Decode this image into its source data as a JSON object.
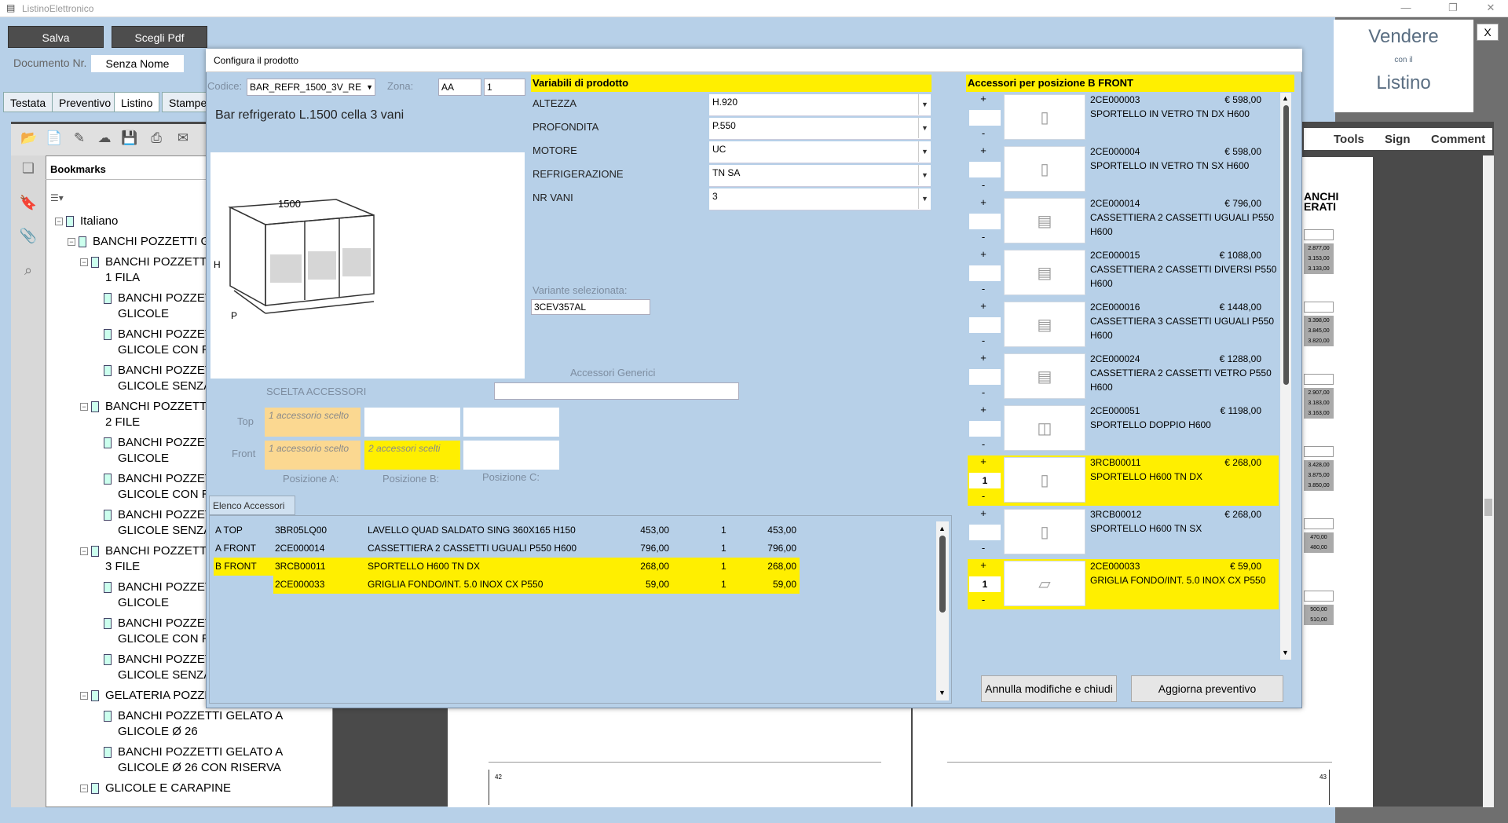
{
  "window": {
    "title": "ListinoElettronico"
  },
  "toolbar": {
    "save": "Salva",
    "choose_pdf": "Scegli Pdf",
    "doc_label": "Documento Nr.",
    "doc_value": "Senza Nome"
  },
  "tabs": [
    "Testata",
    "Preventivo",
    "Listino",
    "Stampe"
  ],
  "brand": {
    "line1": "Vendere",
    "line2": "con il",
    "line3": "Listino",
    "close": "X"
  },
  "pdf_tools": [
    "Tools",
    "Sign",
    "Comment"
  ],
  "bookmarks": {
    "title": "Bookmarks",
    "items": [
      {
        "label": "Italiano",
        "level": 0
      },
      {
        "label": "BANCHI POZZETTI GE",
        "level": 1
      },
      {
        "label": "BANCHI POZZETTI",
        "label2": "1 FILA",
        "level": 2
      },
      {
        "label": "BANCHI POZZET",
        "label2": "GLICOLE",
        "level": 3
      },
      {
        "label": "BANCHI POZZET",
        "label2": "GLICOLE CON RI",
        "level": 3
      },
      {
        "label": "BANCHI POZZET",
        "label2": "GLICOLE SENZA",
        "level": 3
      },
      {
        "label": "BANCHI POZZETTI",
        "label2": "2 FILE",
        "level": 2
      },
      {
        "label": "BANCHI POZZET",
        "label2": "GLICOLE",
        "level": 3
      },
      {
        "label": "BANCHI POZZET",
        "label2": "GLICOLE CON RI",
        "level": 3
      },
      {
        "label": "BANCHI POZZET",
        "label2": "GLICOLE SENZA",
        "level": 3
      },
      {
        "label": "BANCHI POZZETTI",
        "label2": "3 FILE",
        "level": 2
      },
      {
        "label": "BANCHI POZZET",
        "label2": "GLICOLE",
        "level": 3
      },
      {
        "label": "BANCHI POZZET",
        "label2": "GLICOLE CON RI",
        "level": 3
      },
      {
        "label": "BANCHI POZZET",
        "label2": "GLICOLE SENZA",
        "level": 3
      },
      {
        "label": "GELATERIA POZZET",
        "level": 2
      },
      {
        "label": "BANCHI POZZETTI GELATO A",
        "label2": "GLICOLE Ø 26",
        "level": 3
      },
      {
        "label": "BANCHI POZZETTI GELATO A",
        "label2": "GLICOLE Ø 26 CON RISERVA",
        "level": 3
      },
      {
        "label": "GLICOLE E CARAPINE",
        "level": 2
      }
    ]
  },
  "pdf_pages": {
    "right_heading1": "ANCHI",
    "right_heading2": "ERATI",
    "left_num": "42",
    "right_num": "43",
    "right_prices": [
      [
        "2.877,00",
        "3.153,00",
        "3.133,00"
      ],
      [
        "3.398,00",
        "3.845,00",
        "3.820,00"
      ],
      [
        "2.907,00",
        "3.183,00",
        "3.163,00"
      ],
      [
        "3.428,00",
        "3.875,00",
        "3.850,00"
      ],
      [
        "470,00",
        "480,00"
      ],
      [
        "500,00",
        "510,00"
      ]
    ]
  },
  "dialog": {
    "title": "Configura il prodotto",
    "codice_label": "Codice:",
    "codice_value": "BAR_REFR_1500_3V_RE",
    "zona_label": "Zona:",
    "zona_value": "AA",
    "zona_num": "1",
    "product_title": "Bar refrigerato L.1500 cella 3 vani",
    "drawing": {
      "dim": "1500",
      "h": "H",
      "p": "P"
    },
    "variables_header": "Variabili di prodotto",
    "variables": [
      {
        "label": "ALTEZZA",
        "value": "H.920"
      },
      {
        "label": "PROFONDITA",
        "value": "P.550"
      },
      {
        "label": "MOTORE",
        "value": "UC"
      },
      {
        "label": "REFRIGERAZIONE",
        "value": "TN SA"
      },
      {
        "label": "NR VANI",
        "value": "3"
      }
    ],
    "variant_label": "Variante selezionata:",
    "variant_value": "3CEV357AL",
    "generic_acc_label": "Accessori Generici",
    "scelta_label": "SCELTA ACCESSORI",
    "top_label": "Top",
    "front_label": "Front",
    "slots": {
      "top_a": "1 accessorio scelto",
      "front_a": "1 accessorio scelto",
      "front_b": "2 accessori scelti"
    },
    "pos_labels": [
      "Posizione A:",
      "Posizione B:",
      "Posizione C:"
    ],
    "elenco_tab": "Elenco Accessori",
    "elenco": [
      {
        "pos": "A TOP",
        "code": "3BR05LQ00",
        "desc": "LAVELLO QUAD SALDATO SING 360X165 H150",
        "price": "453,00",
        "qty": "1",
        "total": "453,00",
        "hl": false
      },
      {
        "pos": "A FRONT",
        "code": "2CE000014",
        "desc": "CASSETTIERA 2 CASSETTI UGUALI P550 H600",
        "price": "796,00",
        "qty": "1",
        "total": "796,00",
        "hl": false
      },
      {
        "pos": "B FRONT",
        "code": "3RCB00011",
        "desc": "SPORTELLO H600 TN DX",
        "price": "268,00",
        "qty": "1",
        "total": "268,00",
        "hl": true
      },
      {
        "pos": "",
        "code": "2CE000033",
        "desc": "GRIGLIA FONDO/INT. 5.0 INOX CX P550",
        "price": "59,00",
        "qty": "1",
        "total": "59,00",
        "hl": true
      }
    ],
    "acc_header": "Accessori per posizione B FRONT",
    "accessories": [
      {
        "code": "2CE000003",
        "price": "€ 598,00",
        "desc1": "SPORTELLO IN VETRO TN DX H600",
        "desc2": "",
        "qty": "",
        "hl": false,
        "icon": "▯"
      },
      {
        "code": "2CE000004",
        "price": "€ 598,00",
        "desc1": "SPORTELLO IN VETRO TN SX H600",
        "desc2": "",
        "qty": "",
        "hl": false,
        "icon": "▯"
      },
      {
        "code": "2CE000014",
        "price": "€ 796,00",
        "desc1": "CASSETTIERA 2 CASSETTI UGUALI P550",
        "desc2": "H600",
        "qty": "",
        "hl": false,
        "icon": "▤"
      },
      {
        "code": "2CE000015",
        "price": "€ 1088,00",
        "desc1": "CASSETTIERA 2 CASSETTI DIVERSI P550",
        "desc2": "H600",
        "qty": "",
        "hl": false,
        "icon": "▤"
      },
      {
        "code": "2CE000016",
        "price": "€ 1448,00",
        "desc1": "CASSETTIERA 3 CASSETTI UGUALI P550",
        "desc2": "H600",
        "qty": "",
        "hl": false,
        "icon": "▤"
      },
      {
        "code": "2CE000024",
        "price": "€ 1288,00",
        "desc1": "CASSETTIERA 2 CASSETTI VETRO P550",
        "desc2": "H600",
        "qty": "",
        "hl": false,
        "icon": "▤"
      },
      {
        "code": "2CE000051",
        "price": "€ 1198,00",
        "desc1": "SPORTELLO DOPPIO H600",
        "desc2": "",
        "qty": "",
        "hl": false,
        "icon": "◫"
      },
      {
        "code": "3RCB00011",
        "price": "€ 268,00",
        "desc1": "SPORTELLO H600 TN DX",
        "desc2": "",
        "qty": "1",
        "hl": true,
        "icon": "▯"
      },
      {
        "code": "3RCB00012",
        "price": "€ 268,00",
        "desc1": "SPORTELLO H600 TN SX",
        "desc2": "",
        "qty": "",
        "hl": false,
        "icon": "▯"
      },
      {
        "code": "2CE000033",
        "price": "€ 59,00",
        "desc1": "GRIGLIA FONDO/INT. 5.0 INOX CX P550",
        "desc2": "",
        "qty": "1",
        "hl": true,
        "icon": "▱"
      }
    ],
    "plus": "+",
    "minus": "-",
    "btn_cancel": "Annulla modifiche e chiudi",
    "btn_update": "Aggiorna preventivo"
  }
}
